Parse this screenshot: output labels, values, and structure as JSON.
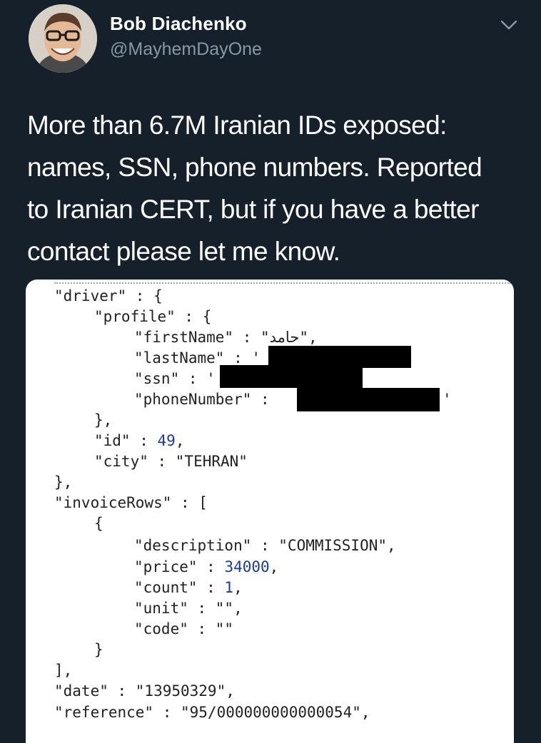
{
  "tweet": {
    "author_name": "Bob Diachenko",
    "author_handle": "@MayhemDayOne",
    "text_lines": [
      "More than 6.7M Iranian IDs exposed:",
      "names, SSN, phone numbers. Reported",
      "to Iranian CERT, but if you have a better",
      "contact please let me know."
    ],
    "icons": {
      "avatar": "avatar-photo",
      "menu": "chevron-down-icon"
    }
  },
  "media": {
    "code_lines": {
      "driver_open": "\"driver\" : {",
      "profile_open": "\"profile\" : {",
      "first_name_key": "\"firstName\" : \"",
      "first_name_value": "حامد",
      "first_name_end": "\",",
      "last_name_key": "\"lastName\" : '",
      "ssn_key": "\"ssn\" : '",
      "phone_key": "\"phoneNumber\" :",
      "phone_end": "'",
      "profile_close": "},",
      "id_key": "\"id\" : ",
      "id_value": "49",
      "id_end": ",",
      "city": "\"city\" : \"TEHRAN\"",
      "driver_close": "},",
      "invoice_open": "\"invoiceRows\" : [",
      "row_open": "{",
      "description": "\"description\" : \"COMMISSION\",",
      "price_key": "\"price\" : ",
      "price_value": "34000",
      "price_end": ",",
      "count_key": "\"count\" : ",
      "count_value": "1",
      "count_end": ",",
      "unit": "\"unit\" : \"\",",
      "code": "\"code\" : \"\"",
      "row_close": "}",
      "invoice_close": "],",
      "date": "\"date\" : \"13950329\",",
      "reference": "\"reference\" : \"95/000000000000054\","
    }
  },
  "colors": {
    "background": "#15202b",
    "handle": "#8899a6",
    "number": "#1a3d8f",
    "redaction": "#000000"
  }
}
